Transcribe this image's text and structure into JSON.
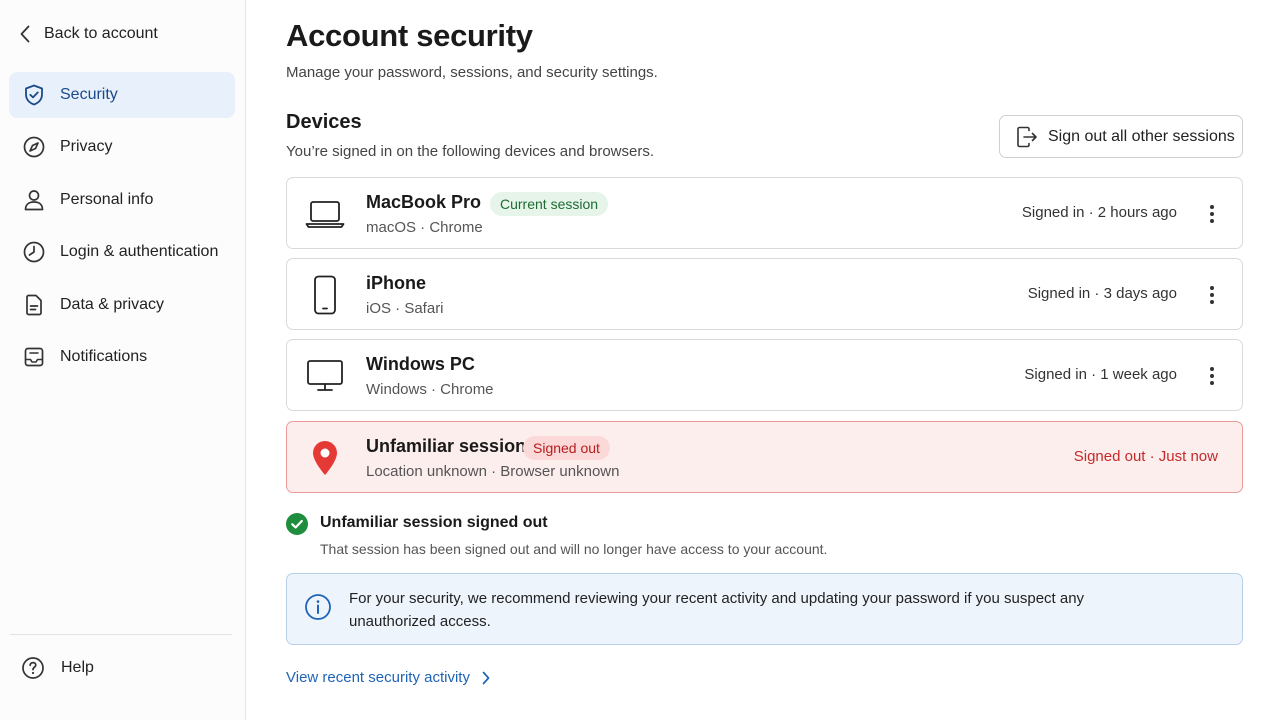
{
  "sidebar": {
    "back_label": "Back to account",
    "items": [
      {
        "label": "Security",
        "icon": "shield-check-icon",
        "active": true
      },
      {
        "label": "Privacy",
        "icon": "compass-icon"
      },
      {
        "label": "Personal info",
        "icon": "person-icon"
      },
      {
        "label": "Login & authentication",
        "icon": "clock-icon"
      },
      {
        "label": "Data & privacy",
        "icon": "document-icon"
      },
      {
        "label": "Notifications",
        "icon": "notification-panel-icon"
      }
    ],
    "help_label": "Help"
  },
  "header": {
    "title": "Account security",
    "subtitle": "Manage your password, sessions, and security settings."
  },
  "devices": {
    "title": "Devices",
    "subtitle": "You’re signed in on the following devices and browsers.",
    "sign_out_all_label": "Sign out all other sessions",
    "list": [
      {
        "name": "MacBook Pro",
        "meta": "macOS · Chrome",
        "badge": "Current session",
        "status": "Signed in · 2 hours ago",
        "icon": "laptop-icon"
      },
      {
        "name": "iPhone",
        "meta": "iOS · Safari",
        "status": "Signed in · 3 days ago",
        "icon": "phone-icon"
      },
      {
        "name": "Windows PC",
        "meta": "Windows · Chrome",
        "status": "Signed in · 1 week ago",
        "icon": "monitor-icon"
      },
      {
        "name": "Unfamiliar session",
        "meta": "Location unknown · Browser unknown",
        "badge": "Signed out",
        "status": "Signed out · Just now",
        "icon": "location-pin-icon"
      }
    ]
  },
  "confirmation": {
    "title": "Unfamiliar session signed out",
    "text": "That session has been signed out and will no longer have access to your account."
  },
  "info": {
    "text": "For your security, we recommend reviewing your recent activity and updating your password if you suspect any unauthorized access."
  },
  "activity_link_label": "View recent security activity",
  "colors": {
    "accent": "#1f63b8",
    "active_nav_bg": "#e8f0fb",
    "success": "#1e8e3e",
    "danger": "#c62828",
    "alert_bg": "#fdeeee",
    "info_bg": "#eef4fc"
  }
}
